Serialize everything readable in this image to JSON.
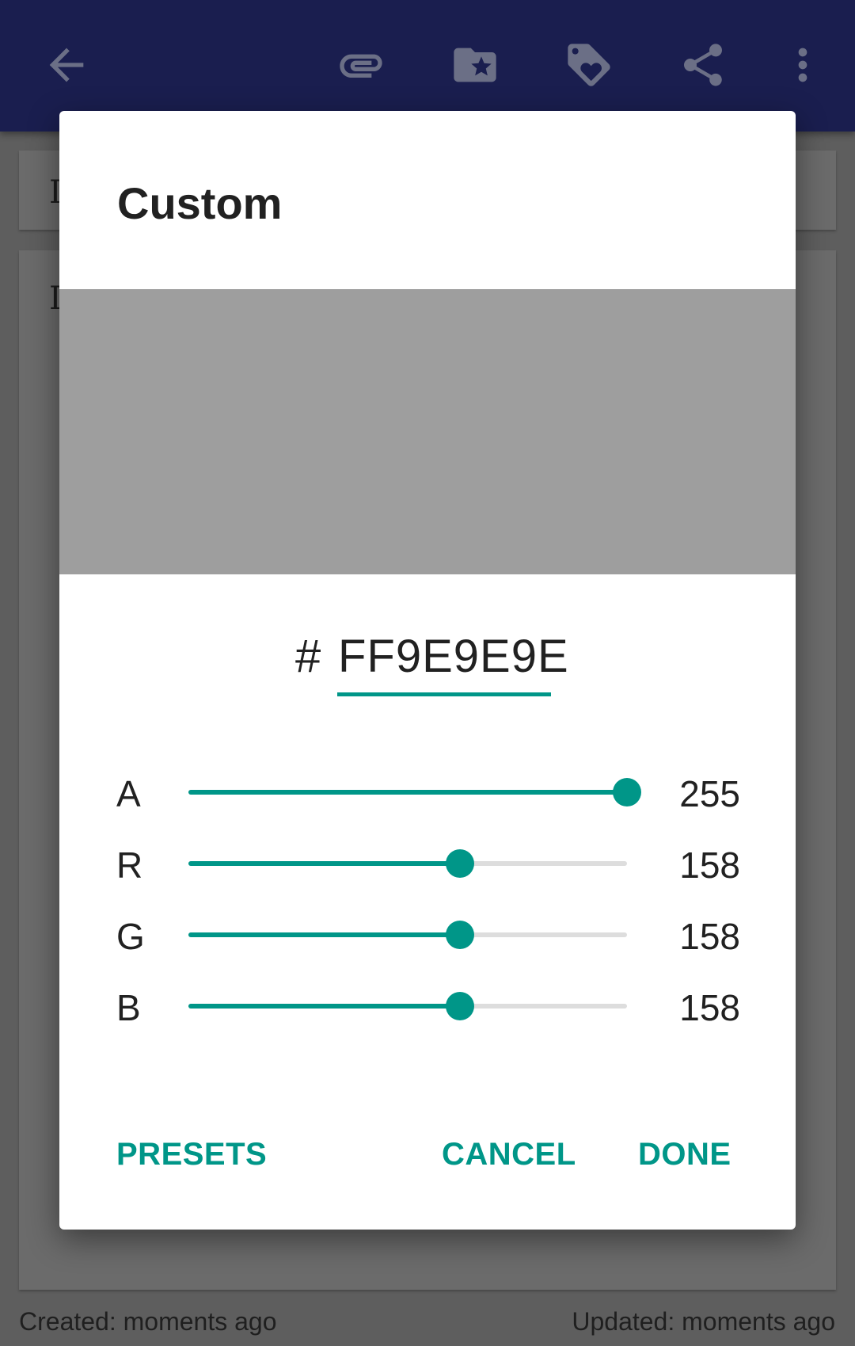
{
  "toolbar": {
    "icons": [
      "back-arrow-icon",
      "attachment-icon",
      "starred-folder-icon",
      "tag-heart-icon",
      "share-icon",
      "more-vert-icon"
    ]
  },
  "background": {
    "card1_letter": "I",
    "card2_letter": "I",
    "created": "Created: moments ago",
    "updated": "Updated: moments ago"
  },
  "dialog": {
    "title": "Custom",
    "preview_color": "#9E9E9E",
    "hash": "#",
    "hex_value": "FF9E9E9E",
    "accent_color": "#009688",
    "channels": [
      {
        "label": "A",
        "value": "255",
        "fraction": 1.0
      },
      {
        "label": "R",
        "value": "158",
        "fraction": 0.62
      },
      {
        "label": "G",
        "value": "158",
        "fraction": 0.62
      },
      {
        "label": "B",
        "value": "158",
        "fraction": 0.62
      }
    ],
    "buttons": {
      "presets": "PRESETS",
      "cancel": "CANCEL",
      "done": "DONE"
    }
  }
}
